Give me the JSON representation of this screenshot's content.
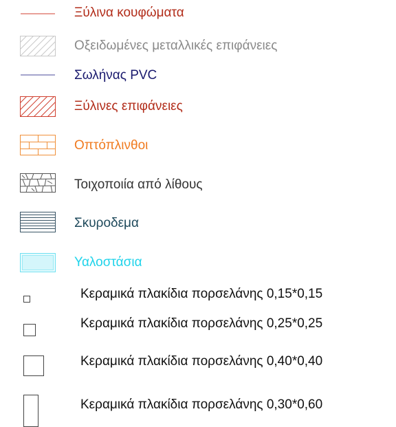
{
  "legend": {
    "items": [
      {
        "label": "Ξύλινα κουφώματα",
        "color": "#b22d1a",
        "symbol": "line"
      },
      {
        "label": "Οξειδωμένες μεταλλικές επιφάνειες",
        "color": "#8a8a8a",
        "symbol": "hatch"
      },
      {
        "label": "Σωλήνας PVC",
        "color": "#1a1a6e",
        "symbol": "line"
      },
      {
        "label": "Ξύλινες επιφάνειες",
        "color": "#b22d1a",
        "symbol": "hatch"
      },
      {
        "label": "Οπτόπλινθοι",
        "color": "#f07b20",
        "symbol": "brick"
      },
      {
        "label": "Τοιχοποιία από λίθους",
        "color": "#333333",
        "symbol": "stone"
      },
      {
        "label": "Σκυροδεμα",
        "color": "#1f4a5c",
        "symbol": "horizontal-lines"
      },
      {
        "label": "Υαλοστάσια",
        "color": "#1fd3ea",
        "symbol": "glass"
      },
      {
        "label": "Κεραμικά πλακίδια πορσελάνης 0,15*0,15",
        "color": "#111111",
        "symbol": "square"
      },
      {
        "label": "Κεραμικά πλακίδια πορσελάνης 0,25*0,25",
        "color": "#111111",
        "symbol": "square"
      },
      {
        "label": "Κεραμικά πλακίδια πορσελάνης 0,40*0,40",
        "color": "#111111",
        "symbol": "square"
      },
      {
        "label": "Κεραμικά πλακίδια πορσελάνης 0,30*0,60",
        "color": "#111111",
        "symbol": "rectangle"
      }
    ]
  }
}
